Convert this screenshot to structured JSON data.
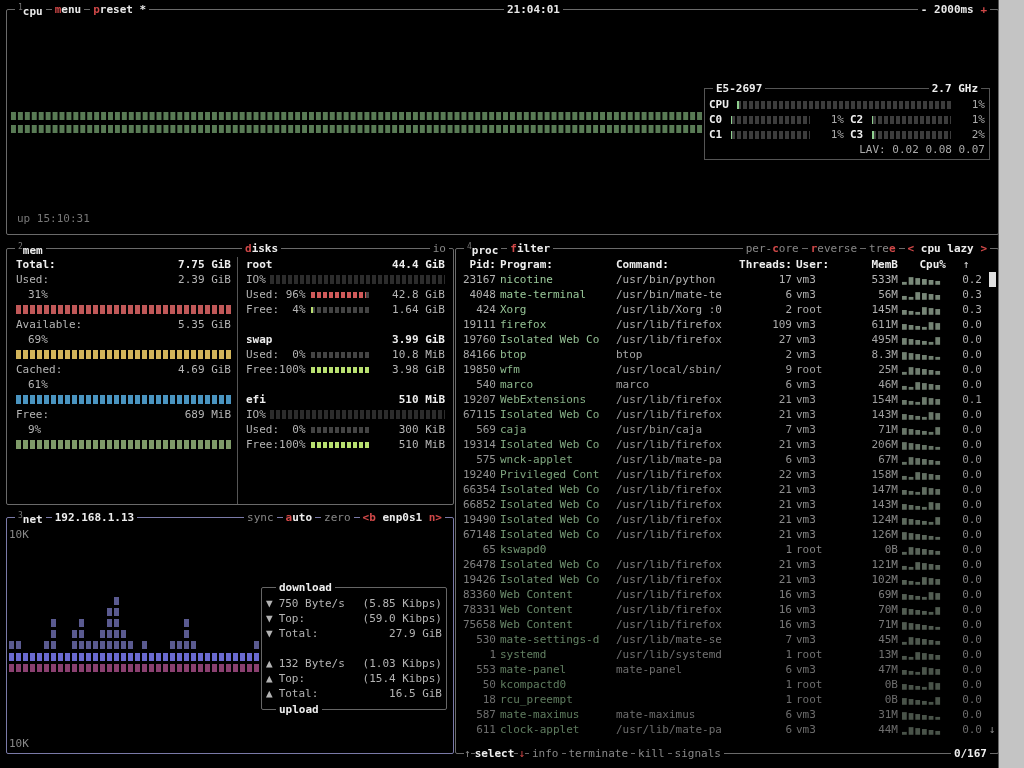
{
  "cpu_box": {
    "tabs": [
      "$^{1}$cpu",
      "**m**enu",
      "**p**reset *"
    ],
    "clock": "21:04:01",
    "interval": "- 2000ms **+**",
    "uptime": "up 15:10:31",
    "info": {
      "model": "E5-2697",
      "freq": "2.7 GHz",
      "total": {
        "label": "CPU",
        "level": 0.01,
        "percent": "1%"
      },
      "cores": [
        {
          "label": "C0",
          "level": 0.01,
          "percent": "1%"
        },
        {
          "label": "C1",
          "level": 0.01,
          "percent": "1%"
        },
        {
          "label": "C2",
          "level": 0.01,
          "percent": "1%"
        },
        {
          "label": "C3",
          "level": 0.02,
          "percent": "2%"
        }
      ],
      "load": "LAV: 0.02 0.08 0.07"
    }
  },
  "mem_box": {
    "title": "$^{2}$mem",
    "total": {
      "label": "Total:",
      "value": "7.75 GiB"
    },
    "items": [
      {
        "label": "Used:",
        "value": "2.39 GiB",
        "percent": "31%",
        "color": "#c05858"
      },
      {
        "label": "Available:",
        "value": "5.35 GiB",
        "percent": "69%",
        "color": "#d2b45a"
      },
      {
        "label": "Cached:",
        "value": "4.69 GiB",
        "percent": "61%",
        "color": "#4a94c0"
      },
      {
        "label": "Free:",
        "value": "689 MiB",
        "percent": "9%",
        "color": "#7e9a68"
      }
    ]
  },
  "disks_box": {
    "title": "**d**isks",
    "io_tab": "io",
    "disks": [
      {
        "name": "root",
        "size": "44.4 GiB",
        "io_label": "IO%",
        "rows": [
          {
            "kind": "used",
            "label": "Used: 96%",
            "level": 0.96,
            "value": "42.8 GiB"
          },
          {
            "kind": "free",
            "label": "Free:  4%",
            "level": 0.04,
            "value": "1.64 GiB"
          }
        ]
      },
      {
        "name": "swap",
        "size": "3.99 GiB",
        "rows": [
          {
            "kind": "used",
            "label": "Used:  0%",
            "level": 0,
            "value": "10.8 MiB"
          },
          {
            "kind": "free",
            "label": "Free:100%",
            "level": 1,
            "value": "3.98 GiB"
          }
        ]
      },
      {
        "name": "efi",
        "size": "510 MiB",
        "io_label": "IO%",
        "rows": [
          {
            "kind": "used",
            "label": "Used:  0%",
            "level": 0,
            "value": "300 KiB"
          },
          {
            "kind": "free",
            "label": "Free:100%",
            "level": 1,
            "value": "510 MiB"
          }
        ]
      }
    ]
  },
  "net_box": {
    "tabs": [
      "$^{3}$net",
      "192.168.1.13"
    ],
    "toggles": [
      {
        "label": "sync",
        "on": false
      },
      {
        "label": "**a**uto",
        "on": true
      },
      {
        "label": "zero",
        "on": false
      }
    ],
    "interface": "**<b** enp0s1 **n>**",
    "scale_top": "10K",
    "scale_bottom": "10K",
    "download": {
      "title": "download",
      "rows": [
        {
          "arrow": "▼",
          "label": "750 Byte/s",
          "value": "(5.85 Kibps)"
        },
        {
          "arrow": "▼",
          "label": "Top:",
          "value": "(59.0 Kibps)"
        },
        {
          "arrow": "▼",
          "label": "Total:",
          "value": "27.9 GiB"
        }
      ]
    },
    "upload": {
      "title": "upload",
      "rows": [
        {
          "arrow": "▲",
          "label": "132 Byte/s",
          "value": "(1.03 Kibps)"
        },
        {
          "arrow": "▲",
          "label": "Top:",
          "value": "(15.4 Kibps)"
        },
        {
          "arrow": "▲",
          "label": "Total:",
          "value": "16.5 GiB"
        }
      ]
    }
  },
  "proc_box": {
    "tabs": [
      "$^{4}$proc",
      "**f**ilter"
    ],
    "options": [
      {
        "label": "per-**c**ore",
        "on": false
      },
      {
        "label": "**r**everse",
        "on": false
      },
      {
        "label": "tre**e**",
        "on": false
      }
    ],
    "sorting": "**<** cpu lazy **>**",
    "columns": [
      "Pid:",
      "Program:",
      "Command:",
      "Threads:",
      "User:",
      "MemB",
      "Cpu%"
    ],
    "scroll_up": "↑",
    "scroll_down": "↓",
    "rows": [
      {
        "pid": "23167",
        "program": "nicotine",
        "command": "/usr/bin/python",
        "threads": "17",
        "user": "vm3",
        "mem": "533M",
        "cpu": "0.2"
      },
      {
        "pid": "4048",
        "program": "mate-terminal",
        "command": "/usr/bin/mate-te",
        "threads": "6",
        "user": "vm3",
        "mem": "56M",
        "cpu": "0.3"
      },
      {
        "pid": "424",
        "program": "Xorg",
        "command": "/usr/lib/Xorg :0",
        "threads": "2",
        "user": "root",
        "mem": "145M",
        "cpu": "0.3"
      },
      {
        "pid": "19111",
        "program": "firefox",
        "command": "/usr/lib/firefox",
        "threads": "109",
        "user": "vm3",
        "mem": "611M",
        "cpu": "0.0"
      },
      {
        "pid": "19760",
        "program": "Isolated Web Co",
        "command": "/usr/lib/firefox",
        "threads": "27",
        "user": "vm3",
        "mem": "495M",
        "cpu": "0.0"
      },
      {
        "pid": "84166",
        "program": "btop",
        "command": "btop",
        "threads": "2",
        "user": "vm3",
        "mem": "8.3M",
        "cpu": "0.0"
      },
      {
        "pid": "19850",
        "program": "wfm",
        "command": "/usr/local/sbin/",
        "threads": "9",
        "user": "root",
        "mem": "25M",
        "cpu": "0.0"
      },
      {
        "pid": "540",
        "program": "marco",
        "command": "marco",
        "threads": "6",
        "user": "vm3",
        "mem": "46M",
        "cpu": "0.0"
      },
      {
        "pid": "19207",
        "program": "WebExtensions",
        "command": "/usr/lib/firefox",
        "threads": "21",
        "user": "vm3",
        "mem": "154M",
        "cpu": "0.1"
      },
      {
        "pid": "67115",
        "program": "Isolated Web Co",
        "command": "/usr/lib/firefox",
        "threads": "21",
        "user": "vm3",
        "mem": "143M",
        "cpu": "0.0"
      },
      {
        "pid": "569",
        "program": "caja",
        "command": "/usr/bin/caja",
        "threads": "7",
        "user": "vm3",
        "mem": "71M",
        "cpu": "0.0"
      },
      {
        "pid": "19314",
        "program": "Isolated Web Co",
        "command": "/usr/lib/firefox",
        "threads": "21",
        "user": "vm3",
        "mem": "206M",
        "cpu": "0.0"
      },
      {
        "pid": "575",
        "program": "wnck-applet",
        "command": "/usr/lib/mate-pa",
        "threads": "6",
        "user": "vm3",
        "mem": "67M",
        "cpu": "0.0"
      },
      {
        "pid": "19240",
        "program": "Privileged Cont",
        "command": "/usr/lib/firefox",
        "threads": "22",
        "user": "vm3",
        "mem": "158M",
        "cpu": "0.0"
      },
      {
        "pid": "66354",
        "program": "Isolated Web Co",
        "command": "/usr/lib/firefox",
        "threads": "21",
        "user": "vm3",
        "mem": "147M",
        "cpu": "0.0"
      },
      {
        "pid": "66852",
        "program": "Isolated Web Co",
        "command": "/usr/lib/firefox",
        "threads": "21",
        "user": "vm3",
        "mem": "143M",
        "cpu": "0.0"
      },
      {
        "pid": "19490",
        "program": "Isolated Web Co",
        "command": "/usr/lib/firefox",
        "threads": "21",
        "user": "vm3",
        "mem": "124M",
        "cpu": "0.0"
      },
      {
        "pid": "67148",
        "program": "Isolated Web Co",
        "command": "/usr/lib/firefox",
        "threads": "21",
        "user": "vm3",
        "mem": "126M",
        "cpu": "0.0"
      },
      {
        "pid": "65",
        "program": "kswapd0",
        "threads": "1",
        "user": "root",
        "mem": "0B",
        "cpu": "0.0"
      },
      {
        "pid": "26478",
        "program": "Isolated Web Co",
        "command": "/usr/lib/firefox",
        "threads": "21",
        "user": "vm3",
        "mem": "121M",
        "cpu": "0.0"
      },
      {
        "pid": "19426",
        "program": "Isolated Web Co",
        "command": "/usr/lib/firefox",
        "threads": "21",
        "user": "vm3",
        "mem": "102M",
        "cpu": "0.0"
      },
      {
        "pid": "83360",
        "program": "Web Content",
        "command": "/usr/lib/firefox",
        "threads": "16",
        "user": "vm3",
        "mem": "69M",
        "cpu": "0.0"
      },
      {
        "pid": "78331",
        "program": "Web Content",
        "command": "/usr/lib/firefox",
        "threads": "16",
        "user": "vm3",
        "mem": "70M",
        "cpu": "0.0"
      },
      {
        "pid": "75658",
        "program": "Web Content",
        "command": "/usr/lib/firefox",
        "threads": "16",
        "user": "vm3",
        "mem": "71M",
        "cpu": "0.0"
      },
      {
        "pid": "530",
        "program": "mate-settings-d",
        "command": "/usr/lib/mate-se",
        "threads": "7",
        "user": "vm3",
        "mem": "45M",
        "cpu": "0.0"
      },
      {
        "pid": "1",
        "program": "systemd",
        "command": "/usr/lib/systemd",
        "threads": "1",
        "user": "root",
        "mem": "13M",
        "cpu": "0.0"
      },
      {
        "pid": "553",
        "program": "mate-panel",
        "command": "mate-panel",
        "threads": "6",
        "user": "vm3",
        "mem": "47M",
        "cpu": "0.0"
      },
      {
        "pid": "50",
        "program": "kcompactd0",
        "threads": "1",
        "user": "root",
        "mem": "0B",
        "cpu": "0.0"
      },
      {
        "pid": "18",
        "program": "rcu_preempt",
        "threads": "1",
        "user": "root",
        "mem": "0B",
        "cpu": "0.0"
      },
      {
        "pid": "587",
        "program": "mate-maximus",
        "command": "mate-maximus",
        "threads": "6",
        "user": "vm3",
        "mem": "31M",
        "cpu": "0.0"
      },
      {
        "pid": "611",
        "program": "clock-applet",
        "command": "/usr/lib/mate-pa",
        "threads": "6",
        "user": "vm3",
        "mem": "44M",
        "cpu": "0.0"
      }
    ],
    "footer": {
      "up": "↑",
      "select": "select",
      "down": "↓",
      "actions": [
        "info",
        "terminate",
        "kill",
        "signals"
      ],
      "count": "0/167"
    }
  }
}
